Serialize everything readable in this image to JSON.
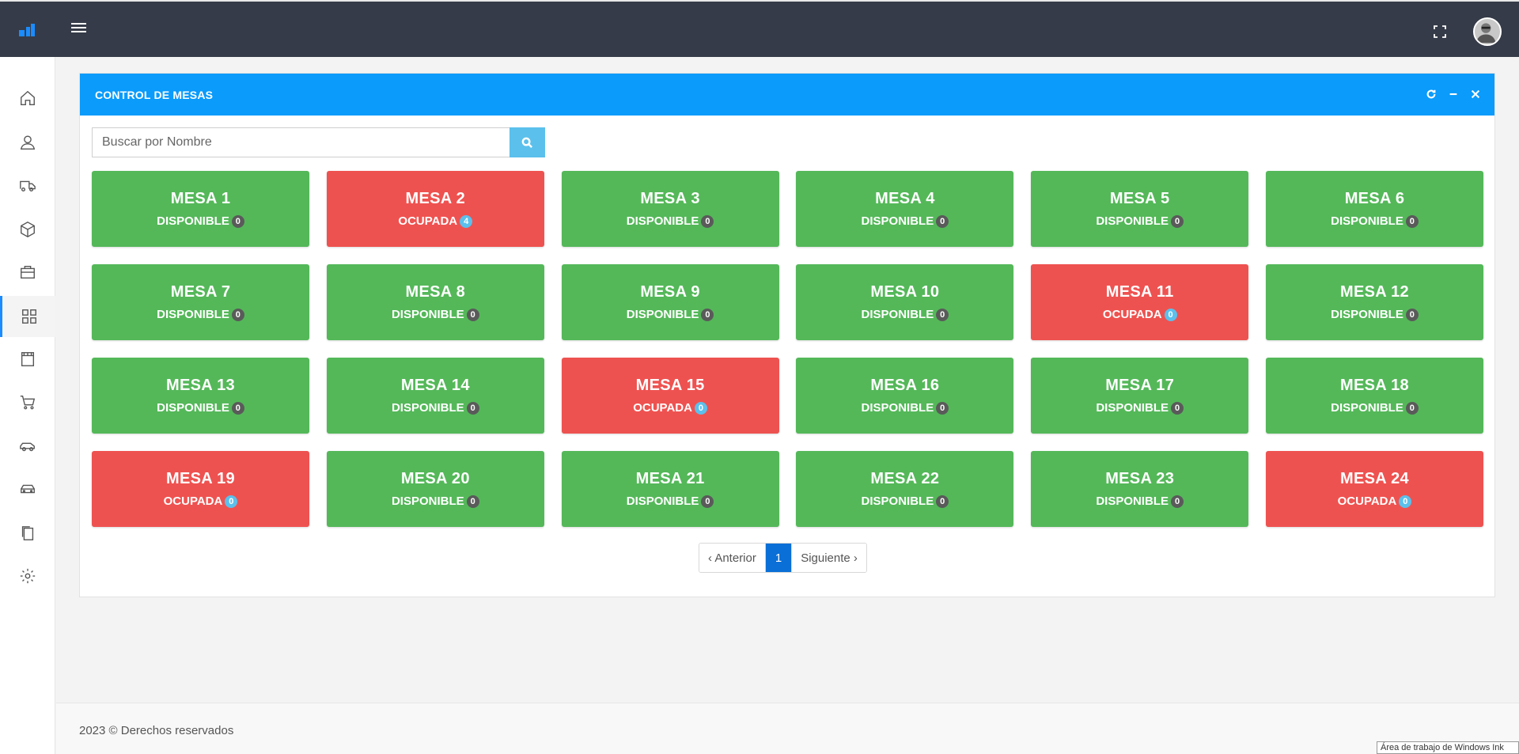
{
  "panel": {
    "title": "CONTROL DE MESAS"
  },
  "search": {
    "placeholder": "Buscar por Nombre",
    "value": ""
  },
  "status_labels": {
    "libre": "DISPONIBLE",
    "ocupada": "OCUPADA"
  },
  "mesas": [
    {
      "name": "MESA 1",
      "status": "DISPONIBLE",
      "count": "0"
    },
    {
      "name": "MESA 2",
      "status": "OCUPADA",
      "count": "4"
    },
    {
      "name": "MESA 3",
      "status": "DISPONIBLE",
      "count": "0"
    },
    {
      "name": "MESA 4",
      "status": "DISPONIBLE",
      "count": "0"
    },
    {
      "name": "MESA 5",
      "status": "DISPONIBLE",
      "count": "0"
    },
    {
      "name": "MESA 6",
      "status": "DISPONIBLE",
      "count": "0"
    },
    {
      "name": "MESA 7",
      "status": "DISPONIBLE",
      "count": "0"
    },
    {
      "name": "MESA 8",
      "status": "DISPONIBLE",
      "count": "0"
    },
    {
      "name": "MESA 9",
      "status": "DISPONIBLE",
      "count": "0"
    },
    {
      "name": "MESA 10",
      "status": "DISPONIBLE",
      "count": "0"
    },
    {
      "name": "MESA 11",
      "status": "OCUPADA",
      "count": "0"
    },
    {
      "name": "MESA 12",
      "status": "DISPONIBLE",
      "count": "0"
    },
    {
      "name": "MESA 13",
      "status": "DISPONIBLE",
      "count": "0"
    },
    {
      "name": "MESA 14",
      "status": "DISPONIBLE",
      "count": "0"
    },
    {
      "name": "MESA 15",
      "status": "OCUPADA",
      "count": "0"
    },
    {
      "name": "MESA 16",
      "status": "DISPONIBLE",
      "count": "0"
    },
    {
      "name": "MESA 17",
      "status": "DISPONIBLE",
      "count": "0"
    },
    {
      "name": "MESA 18",
      "status": "DISPONIBLE",
      "count": "0"
    },
    {
      "name": "MESA 19",
      "status": "OCUPADA",
      "count": "0"
    },
    {
      "name": "MESA 20",
      "status": "DISPONIBLE",
      "count": "0"
    },
    {
      "name": "MESA 21",
      "status": "DISPONIBLE",
      "count": "0"
    },
    {
      "name": "MESA 22",
      "status": "DISPONIBLE",
      "count": "0"
    },
    {
      "name": "MESA 23",
      "status": "DISPONIBLE",
      "count": "0"
    },
    {
      "name": "MESA 24",
      "status": "OCUPADA",
      "count": "0"
    }
  ],
  "pagination": {
    "prev": "‹ Anterior",
    "current": "1",
    "next": "Siguiente ›"
  },
  "sidebar": {
    "icons": [
      "home-icon",
      "user-icon",
      "truck-icon",
      "box-icon",
      "briefcase-icon",
      "grid-icon",
      "store-icon",
      "cart-icon",
      "car-icon",
      "vehicle-icon",
      "documents-icon",
      "settings-icon"
    ],
    "active_index": 5
  },
  "footer": {
    "text": "2023 © Derechos reservados"
  },
  "taskbar_hint": "Área de trabajo de Windows Ink",
  "colors": {
    "topbar": "#353b48",
    "panel_header": "#0a9bfb",
    "disponible": "#54b859",
    "ocupada": "#ee5250",
    "accent": "#0a6fd6"
  }
}
